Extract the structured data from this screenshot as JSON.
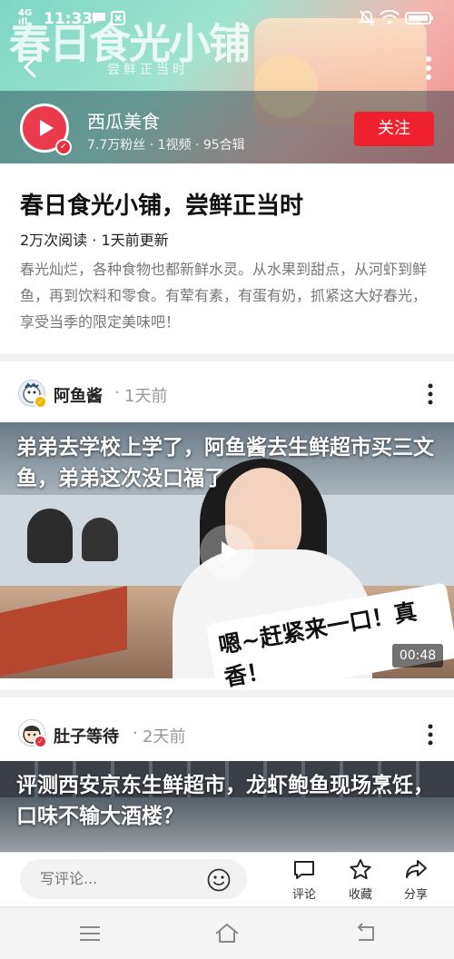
{
  "status_bar": {
    "time": "11:33",
    "network": "4G\nill"
  },
  "banner": {
    "artwork_title": "春日食光小铺",
    "artwork_subtitle": "尝鲜正当时"
  },
  "author": {
    "name": "西瓜美食",
    "stats": "7.7万粉丝 · 1视频 · 95合辑",
    "follow_label": "关注"
  },
  "collection": {
    "title": "春日食光小铺，尝鲜正当时",
    "meta": "2万次阅读 · 1天前更新",
    "description": "春光灿烂，各种食物也都新鲜水灵。从水果到甜点，从河虾到鲜鱼，再到饮料和零食。有荤有素，有蛋有奶，抓紧这大好春光，享受当季的限定美味吧！"
  },
  "feed": [
    {
      "user": "阿鱼酱",
      "ago": "1天前",
      "title": "弟弟去学校上学了，阿鱼酱去生鲜超市买三文鱼，弟弟这次没口福了",
      "caption": "嗯~赶紧来一口！真香！",
      "duration": "00:48"
    },
    {
      "user": "肚子等待",
      "ago": "2天前",
      "title": "评测西安京东生鲜超市，龙虾鲍鱼现场烹饪，口味不输大酒楼？"
    }
  ],
  "action_bar": {
    "comment_placeholder": "写评论...",
    "comment_label": "评论",
    "favorite_label": "收藏",
    "share_label": "分享"
  },
  "colors": {
    "accent": "#f0212f",
    "verified": "#e8303f"
  }
}
